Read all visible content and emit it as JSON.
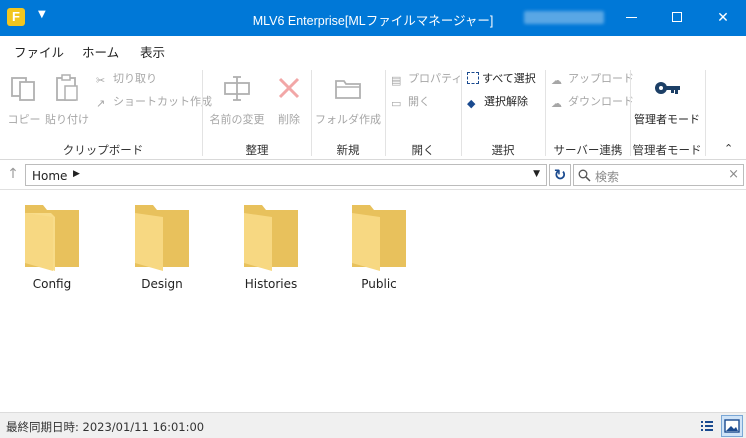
{
  "window": {
    "title": "MLV6 Enterprise[MLファイルマネージャー]",
    "app_icon_letter": "F"
  },
  "ribbon_tabs": [
    {
      "label": "ファイル"
    },
    {
      "label": "ホーム"
    },
    {
      "label": "表示"
    }
  ],
  "ribbon": {
    "clipboard": {
      "copy": "コピー",
      "paste": "貼り付け",
      "cut": "切り取り",
      "shortcut": "ショートカット作成",
      "group": "クリップボード"
    },
    "organize": {
      "rename": "名前の変更",
      "delete": "削除",
      "group": "整理"
    },
    "new": {
      "new_folder": "フォルダ作成",
      "group": "新規"
    },
    "open": {
      "properties": "プロパティ",
      "open": "開く",
      "group": "開く"
    },
    "select": {
      "select_all": "すべて選択",
      "deselect": "選択解除",
      "group": "選択"
    },
    "server": {
      "upload": "アップロード",
      "download": "ダウンロード",
      "group": "サーバー連携"
    },
    "admin": {
      "admin_mode": "管理者モード",
      "group": "管理者モード"
    }
  },
  "address": {
    "path": "Home",
    "search_placeholder": "検索"
  },
  "folders": [
    {
      "name": "Config"
    },
    {
      "name": "Design"
    },
    {
      "name": "Histories"
    },
    {
      "name": "Public"
    }
  ],
  "status": {
    "last_sync": "最終同期日時: 2023/01/11 16:01:00"
  },
  "colors": {
    "titlebar": "#0078d7",
    "folder": "#f5d77a",
    "accent": "#2b6ac9"
  }
}
